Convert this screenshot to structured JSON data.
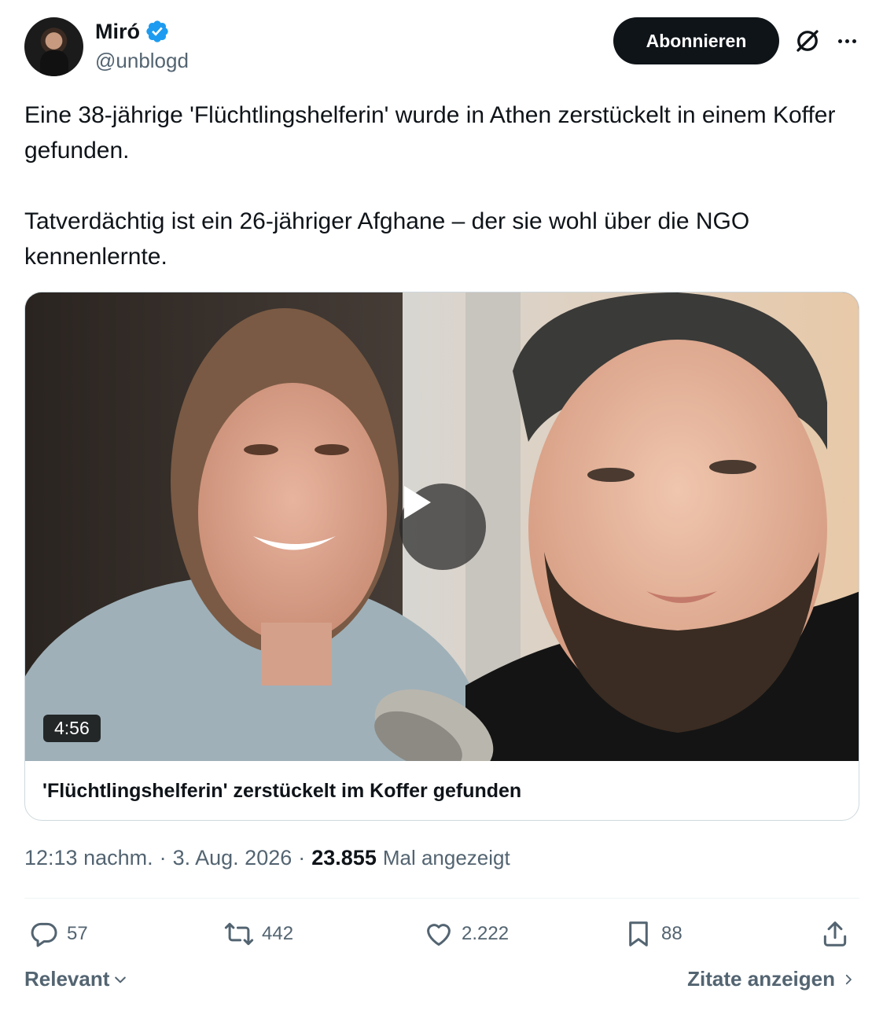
{
  "author": {
    "name": "Miró",
    "handle": "@unblogd",
    "verified": true,
    "verified_color": "#1d9bf0"
  },
  "header": {
    "subscribe_label": "Abonnieren",
    "grok_icon": "grok-icon",
    "more_icon": "more-dots-icon"
  },
  "tweet": {
    "paragraph1": "Eine 38-jährige 'Flüchtlingshelferin' wurde in Athen zerstückelt in einem Koffer gefunden.",
    "paragraph2": "Tatverdächtig ist ein 26-jähriger Afghane – der sie wohl über die NGO kennenlernte."
  },
  "card": {
    "duration": "4:56",
    "title": "'Flüchtlingshelferin' zerstückelt im Koffer gefunden",
    "play_icon": "play-icon"
  },
  "meta": {
    "time": "12:13 nachm.",
    "separator": "·",
    "date": "3. Aug. 2026",
    "separator2": "·",
    "views": "23.855",
    "views_label": "Mal angezeigt"
  },
  "actions": {
    "replies": "57",
    "reposts": "442",
    "likes": "2.222",
    "bookmarks": "88"
  },
  "footer": {
    "sort_label": "Relevant",
    "quotes_label": "Zitate anzeigen"
  },
  "colors": {
    "text": "#0f1419",
    "secondary": "#536471",
    "border": "#cfd9de",
    "button_bg": "#0f1419"
  }
}
